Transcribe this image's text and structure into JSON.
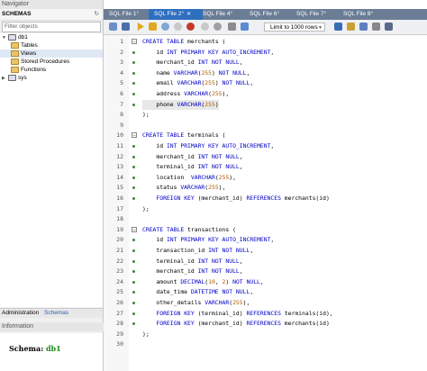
{
  "navigator": {
    "title": "Navigator",
    "schemas_label": "SCHEMAS",
    "filter_placeholder": "Filter objects",
    "tree": [
      {
        "label": "db1",
        "level": 0,
        "kind": "db",
        "expanded": true
      },
      {
        "label": "Tables",
        "level": 1,
        "kind": "folder"
      },
      {
        "label": "Views",
        "level": 1,
        "kind": "folder",
        "selected": true
      },
      {
        "label": "Stored Procedures",
        "level": 1,
        "kind": "folder"
      },
      {
        "label": "Functions",
        "level": 1,
        "kind": "folder"
      },
      {
        "label": "sys",
        "level": 0,
        "kind": "db",
        "expanded": false
      }
    ],
    "bottom_tabs": [
      "Administration",
      "Schemas"
    ],
    "active_bottom_tab": "Schemas"
  },
  "information": {
    "title": "Information",
    "schema_label": "Schema:",
    "schema_value": "db1"
  },
  "tabs": [
    {
      "label": "SQL File 1°",
      "active": false
    },
    {
      "label": "SQL File 2°",
      "active": true
    },
    {
      "label": "SQL File 4°",
      "active": false
    },
    {
      "label": "SQL File 6°",
      "active": false
    },
    {
      "label": "SQL File 7°",
      "active": false
    },
    {
      "label": "SQL File 8°",
      "active": false
    }
  ],
  "toolbar": {
    "limit_label": "Limit to 1000 rows"
  },
  "code_lines": [
    {
      "n": "1",
      "text": "CREATE TABLE merchants (",
      "marker": "block"
    },
    {
      "n": "2",
      "text": "    id INT PRIMARY KEY AUTO_INCREMENT,"
    },
    {
      "n": "3",
      "text": "    merchant_id INT NOT NULL,"
    },
    {
      "n": "4",
      "text": "    name VARCHAR(255) NOT NULL,"
    },
    {
      "n": "5",
      "text": "    email VARCHAR(255) NOT NULL,"
    },
    {
      "n": "6",
      "text": "    address VARCHAR(255),"
    },
    {
      "n": "7",
      "text": "    phone VARCHAR(255)",
      "highlight": true
    },
    {
      "n": "8",
      "text": ");",
      "marker": "end"
    },
    {
      "n": "9",
      "text": ""
    },
    {
      "n": "10",
      "text": "CREATE TABLE terminals (",
      "marker": "block"
    },
    {
      "n": "11",
      "text": "    id INT PRIMARY KEY AUTO_INCREMENT,"
    },
    {
      "n": "12",
      "text": "    merchant_id INT NOT NULL,"
    },
    {
      "n": "13",
      "text": "    terminal_id INT NOT NULL,"
    },
    {
      "n": "14",
      "text": "    location  VARCHAR(255),"
    },
    {
      "n": "15",
      "text": "    status VARCHAR(255),"
    },
    {
      "n": "16",
      "text": "    FOREIGN KEY (merchant_id) REFERENCES merchants(id)"
    },
    {
      "n": "17",
      "text": ");",
      "marker": "end"
    },
    {
      "n": "18",
      "text": ""
    },
    {
      "n": "19",
      "text": "CREATE TABLE transactions (",
      "marker": "block"
    },
    {
      "n": "20",
      "text": "    id INT PRIMARY KEY AUTO_INCREMENT,"
    },
    {
      "n": "21",
      "text": "    transaction_id INT NOT NULL,"
    },
    {
      "n": "22",
      "text": "    terminal_id INT NOT NULL,"
    },
    {
      "n": "23",
      "text": "    merchant_id INT NOT NULL,"
    },
    {
      "n": "24",
      "text": "    amount DECIMAL(10, 2) NOT NULL,"
    },
    {
      "n": "25",
      "text": "    date_time DATETIME NOT NULL,"
    },
    {
      "n": "26",
      "text": "    other_details VARCHAR(255),"
    },
    {
      "n": "27",
      "text": "    FOREIGN KEY (terminal_id) REFERENCES terminals(id),"
    },
    {
      "n": "28",
      "text": "    FOREIGN KEY (merchant_id) REFERENCES merchants(id)"
    },
    {
      "n": "29",
      "text": ");",
      "marker": "end"
    },
    {
      "n": "30",
      "text": ""
    }
  ],
  "colors": {
    "keyword": "#0000c8",
    "number": "#b05a00",
    "active_tab": "#2f6fc0",
    "tab_bar": "#6b7d95",
    "schema_value": "#1a8a1a"
  }
}
